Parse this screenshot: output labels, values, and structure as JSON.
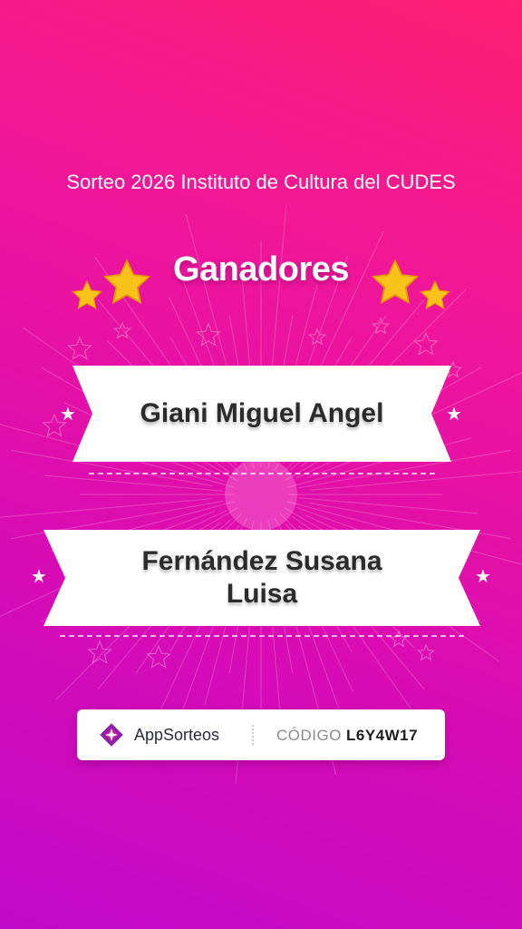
{
  "raffle": {
    "title": "Sorteo 2026 Instituto de Cultura del CUDES",
    "heading": "Ganadores"
  },
  "winners": [
    {
      "name": "Giani Miguel Angel"
    },
    {
      "name": "Fernández Susana Luisa"
    }
  ],
  "footer": {
    "brand": "AppSorteos",
    "code_label": "CÓDIGO",
    "code_value": "L6Y4W17"
  },
  "colors": {
    "background_top": "#ff1f72",
    "background_bottom": "#c00ac9",
    "star_gold": "#f7c31b",
    "banner": "#ffffff",
    "text_dark": "#2b2b2b",
    "logo_purple": "#8e1fa6"
  },
  "icons": [
    "star-icon",
    "appsorteos-logo-icon"
  ]
}
